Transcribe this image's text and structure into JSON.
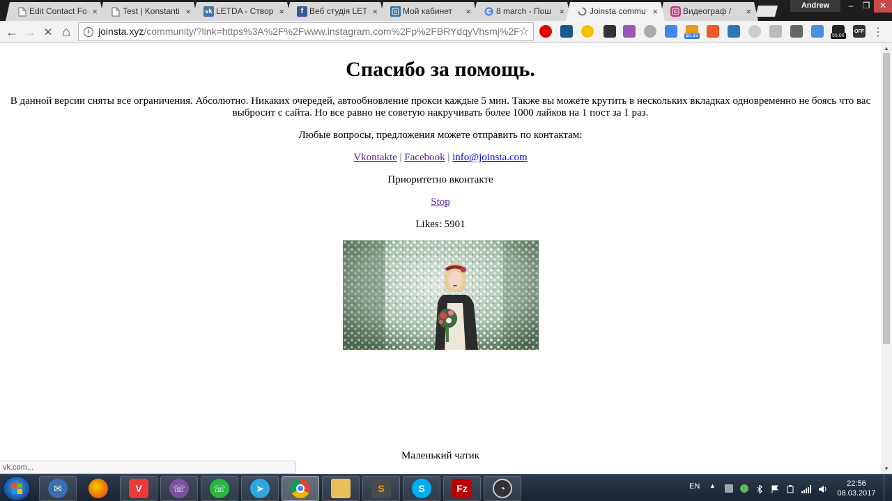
{
  "window": {
    "user": "Andrew",
    "tabs": [
      {
        "title": "Edit Contact Fo",
        "icon": "document-icon"
      },
      {
        "title": "Test | Konstanti",
        "icon": "document-icon"
      },
      {
        "title": "LETDA - Створе",
        "icon": "vk-icon"
      },
      {
        "title": "Веб студія LETD",
        "icon": "facebook-icon"
      },
      {
        "title": "Мой кабинет",
        "icon": "instagram-icon"
      },
      {
        "title": "8 march - Пош",
        "icon": "google-icon"
      },
      {
        "title": "Joinsta commu",
        "icon": "loading-spinner-icon"
      },
      {
        "title": "Видеограф /",
        "icon": "instagram-icon"
      }
    ],
    "tab_close": "×",
    "window_buttons": {
      "minimize": "–",
      "restore": "❐",
      "close": "✕"
    }
  },
  "toolbar": {
    "url_host": "joinsta.xyz",
    "url_path": "/community/?link=https%3A%2F%2Fwww.instagram.com%2Fp%2FBRYdqyVhsmj%2F",
    "star": "☆",
    "back": "←",
    "forward": "→",
    "stop": "✕",
    "home": "⌂",
    "menu": "⋮",
    "ext_badge_price": "$0.93",
    "ext_badge_timer": "55:00",
    "ext_badge_off": "OFF"
  },
  "page": {
    "title": "Спасибо за помощь.",
    "intro": "В данной версии сняты все ограничения. Абсолютно. Никаких очередей, автообновление прокси каждые 5 мин. Также вы можете крутить в нескольких вкладках одновременно не боясь что вас выбросит с сайта. Но все равно не советую накручивать более 1000 лайков на 1 пост за 1 раз.",
    "questions": "Любые вопросы, предложения можете отправить по контактам:",
    "links": {
      "vk": "Vkontakte",
      "sep1": "|",
      "facebook": "Facebook",
      "sep2": "|",
      "email": "info@joinsta.com"
    },
    "priority": "Приоритетно вконтакте",
    "stop_link": "Stop",
    "likes": "Likes: 5901",
    "chat_label": "Маленький чатик"
  },
  "status_bar": {
    "text": "vk.com..."
  },
  "taskbar": {
    "apps": [
      {
        "name": "thunderbird",
        "open": true
      },
      {
        "name": "firefox",
        "open": false
      },
      {
        "name": "vivaldi",
        "open": true
      },
      {
        "name": "viber",
        "open": true
      },
      {
        "name": "whatsapp",
        "open": true
      },
      {
        "name": "telegram",
        "open": true
      },
      {
        "name": "chrome",
        "open": true,
        "active": true
      },
      {
        "name": "explorer",
        "open": true
      },
      {
        "name": "sublime-text",
        "open": true
      },
      {
        "name": "skype",
        "open": true
      },
      {
        "name": "filezilla",
        "open": true
      },
      {
        "name": "speed-monitor",
        "open": true
      }
    ],
    "language": "EN",
    "time": "22:56",
    "date": "08.03.2017"
  },
  "colors": {
    "link_visited": "#551a8b",
    "link_unvisited": "#0000ee",
    "tab_active": "#f2f2f2",
    "tab_inactive": "#d9d9d9"
  }
}
